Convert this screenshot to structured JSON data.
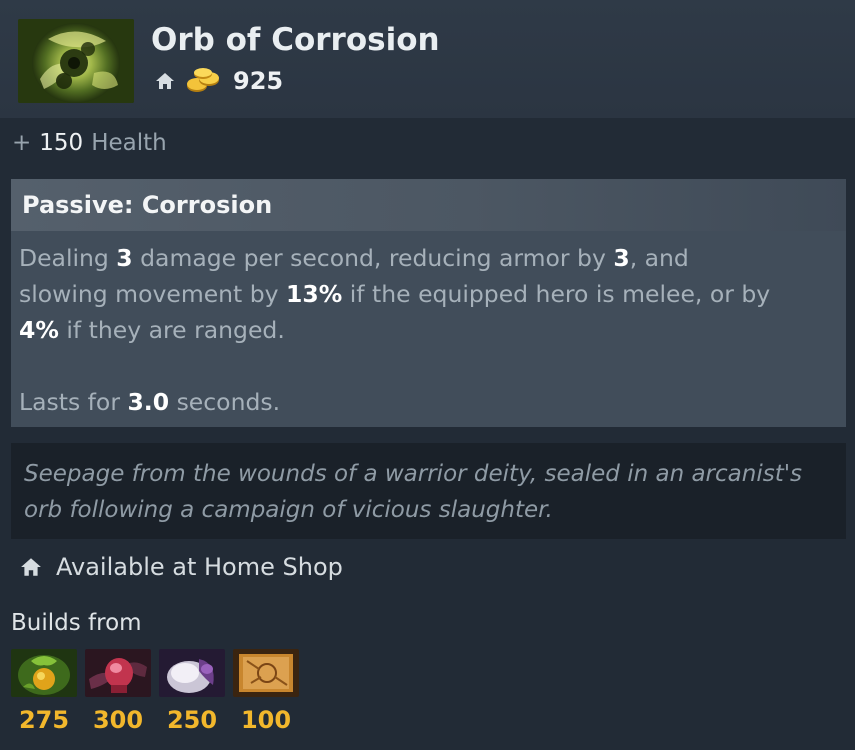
{
  "item": {
    "name": "Orb of Corrosion",
    "cost": "925",
    "icon": "orb-of-corrosion-icon"
  },
  "stats": [
    {
      "prefix": "+",
      "value": "150",
      "name": "Health"
    }
  ],
  "ability": {
    "title": "Passive: Corrosion",
    "line1_a": "Dealing ",
    "line1_b": "3",
    "line1_c": " damage per second, reducing armor by ",
    "line1_d": "3",
    "line1_e": ", and",
    "line2_a": "slowing movement by ",
    "line2_b": "13%",
    "line2_c": " if the equipped hero is melee, or by",
    "line3_a": "4%",
    "line3_b": " if they are ranged.",
    "line4_a": "Lasts for ",
    "line4_b": "3.0",
    "line4_c": " seconds."
  },
  "lore": {
    "line1": "Seepage from the wounds of a warrior deity, sealed in an arcanist's",
    "line2": "orb following a campaign of vicious slaughter."
  },
  "shop": {
    "availability": "Available at Home Shop",
    "icon": "home-icon"
  },
  "builds": {
    "label": "Builds from",
    "components": [
      {
        "icon": "blight-stone-icon",
        "cost": "275"
      },
      {
        "icon": "wind-lace-icon",
        "cost": "300"
      },
      {
        "icon": "fluffy-hat-icon",
        "cost": "250"
      },
      {
        "icon": "recipe-scroll-icon",
        "cost": "100"
      }
    ]
  },
  "colors": {
    "background": "#222b36",
    "header": "#2e3946",
    "ability_body": "#414d5a",
    "lore_box": "#1a2129",
    "gold": "#f2b72c",
    "text_highlight": "#ffffff",
    "text_muted": "#a6b1ba"
  }
}
